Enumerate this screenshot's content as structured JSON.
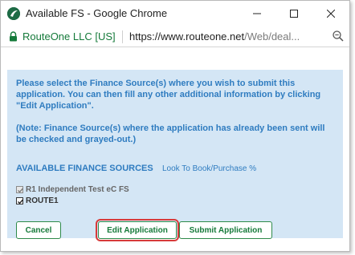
{
  "window": {
    "title": "Available FS - Google Chrome",
    "icon": "routeone-logo-icon"
  },
  "addressbar": {
    "site_name": "RouteOne LLC [US]",
    "url_host": "https://www.routeone.net",
    "url_path": "/Web/deal..."
  },
  "dialog": {
    "instructions": "Please select the Finance Source(s) where you wish to submit this application.  You can then fill any other additional information by clicking \"Edit Application\".",
    "note": "(Note: Finance Source(s) where the application has already been sent will be checked and grayed-out.)",
    "sources_header": "AVAILABLE FINANCE SOURCES",
    "sources_subheader": "Look To Book/Purchase %",
    "sources": [
      {
        "label": "R1 Independent Test eC FS",
        "checked": true,
        "disabled": true
      },
      {
        "label": "ROUTE1",
        "checked": true,
        "disabled": false
      }
    ],
    "buttons": {
      "cancel": "Cancel",
      "edit": "Edit Application",
      "submit": "Submit Application"
    }
  },
  "colors": {
    "accent_text": "#2f7cc0",
    "panel_bg": "#d4e6f5",
    "button_green": "#167a3a",
    "highlight_red": "#d83a3a",
    "secure_green": "#157a3a"
  }
}
